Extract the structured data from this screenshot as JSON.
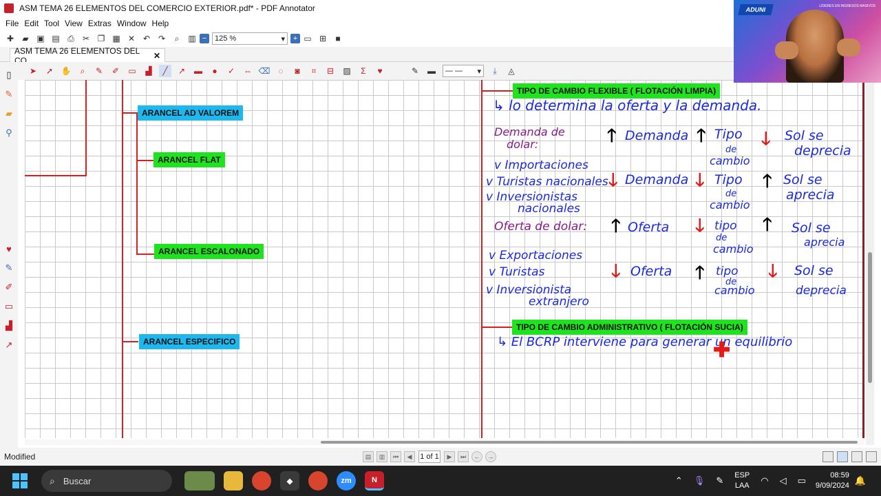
{
  "window": {
    "title": "ASM TEMA 26 ELEMENTOS DEL COMERCIO EXTERIOR.pdf* - PDF Annotator"
  },
  "menu": [
    "File",
    "Edit",
    "Tool",
    "View",
    "Extras",
    "Window",
    "Help"
  ],
  "toolbar": {
    "zoom": "125 %"
  },
  "tab": {
    "label": "ASM TEMA 26 ELEMENTOS DEL CO...",
    "close": "✕"
  },
  "document": {
    "boxes": {
      "ad_valorem": "ARANCEL AD VALOREM",
      "flat": "ARANCEL FLAT",
      "escalonado": "ARANCEL ESCALONADO",
      "especifico": "ARANCEL ESPECIFICO",
      "flexible": "TIPO DE CAMBIO FLEXIBLE ( FLOTACIÓN LIMPIA)",
      "administrativo": "TIPO DE CAMBIO ADMINISTRATIVO ( FLOTACIÓN SUCIA)"
    },
    "handwriting": {
      "h1": "↳ lo determina la oferta y la demanda.",
      "h2a": "Demanda de",
      "h2b": "dolar:",
      "h3": "Demanda",
      "h4a": "Tipo",
      "h4b": "de",
      "h4c": "cambio",
      "h5a": "Sol se",
      "h5b": "deprecia",
      "h6": "v Importaciones",
      "h7": "v Turistas nacionales",
      "h8a": "v Inversionistas",
      "h8b": "nacionales",
      "h9": "Demanda",
      "h10a": "Tipo",
      "h10b": "de",
      "h10c": "cambio",
      "h11a": "Sol se",
      "h11b": "aprecia",
      "h12": "Oferta de dolar:",
      "h13": "Oferta",
      "h14a": "tipo",
      "h14b": "de",
      "h14c": "cambio",
      "h15a": "Sol se",
      "h15b": "aprecia",
      "h16": "v Exportaciones",
      "h17": "v Turistas",
      "h18a": "v Inversionista",
      "h18b": "extranjero",
      "h19": "Oferta",
      "h20a": "tipo",
      "h20b": "de",
      "h20c": "cambio",
      "h21a": "Sol se",
      "h21b": "deprecia",
      "h22": "↳ El BCRP interviene para generar un equilibrio"
    }
  },
  "status": {
    "left": "Modified",
    "page": "1 of 1"
  },
  "taskbar": {
    "search": "Buscar",
    "lang1": "ESP",
    "lang2": "LAA",
    "time": "08:59",
    "date": "9/09/2024"
  },
  "webcam": {
    "brand": "ADUNI",
    "slogan": "LÍDERES EN INGRESOS MASIVOS"
  },
  "colors": {
    "red_line": "#d81e1e",
    "blue_box": "#1eb8ee",
    "green_box": "#1ee31e",
    "ink_blue": "#1a2ae0",
    "ink_purple": "#8a1a8a"
  }
}
